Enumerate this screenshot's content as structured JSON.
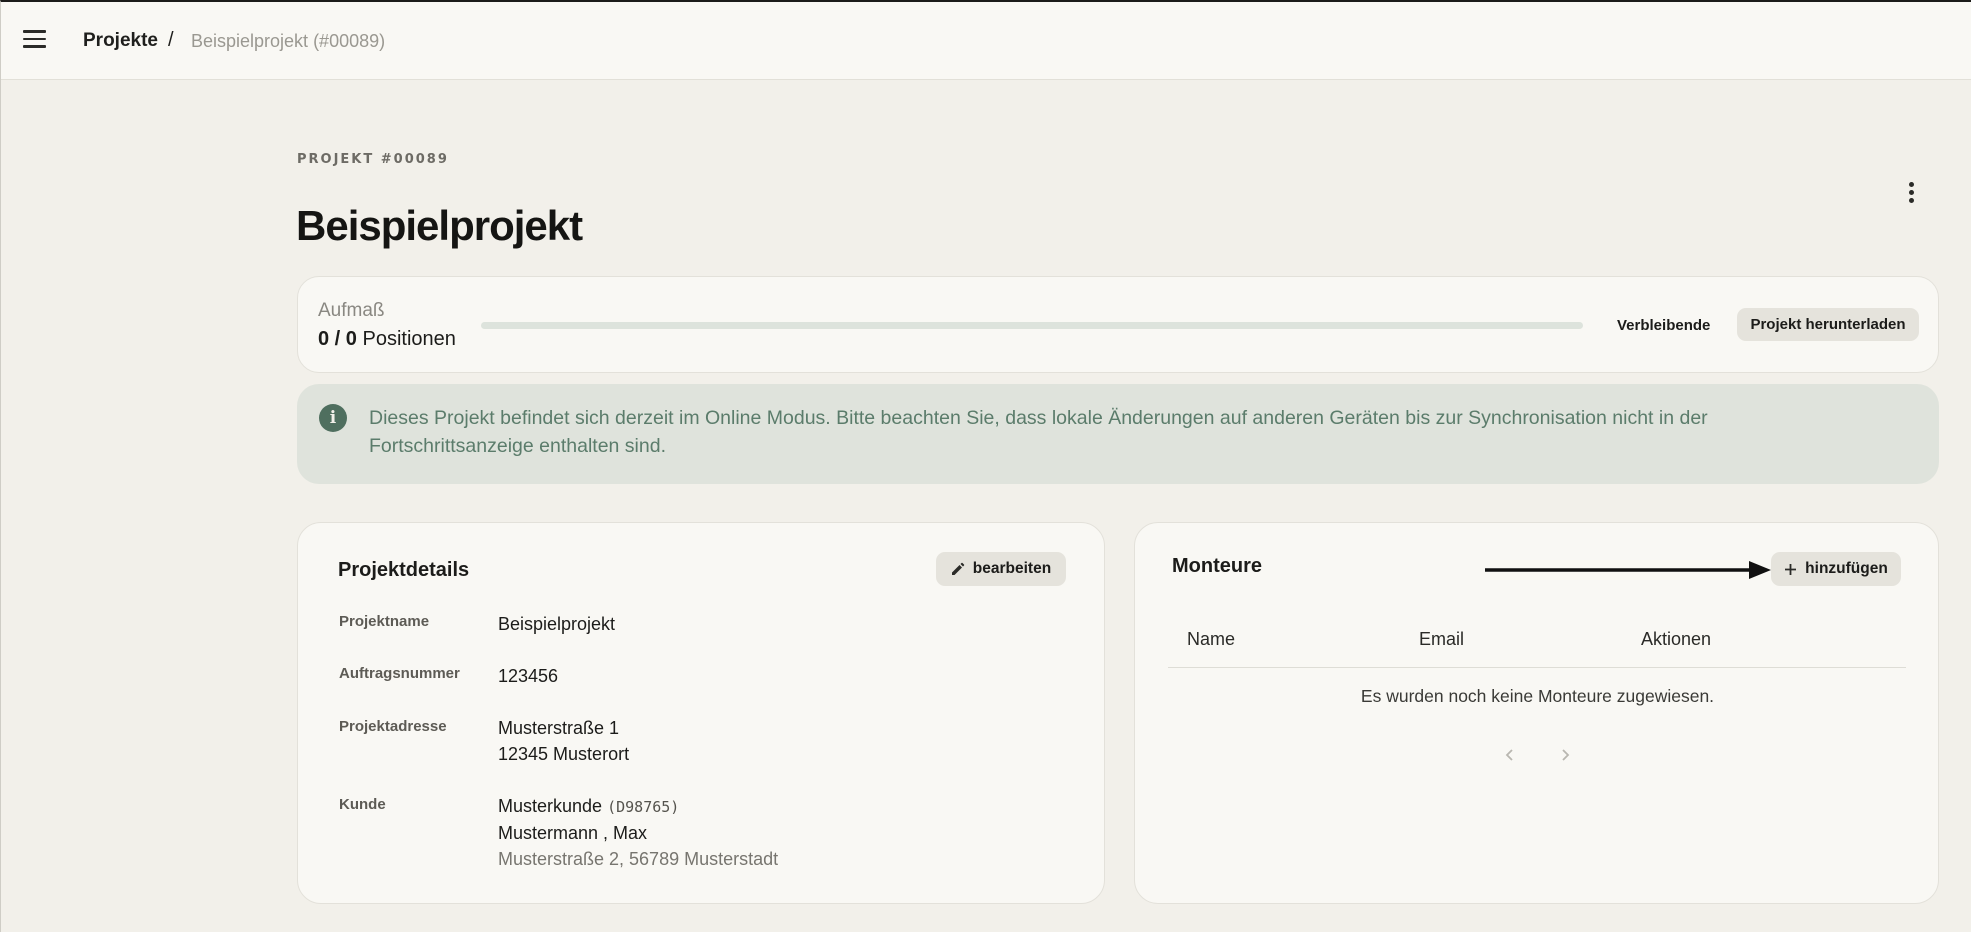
{
  "breadcrumb": {
    "root": "Projekte",
    "separator": "/",
    "current": "Beispielprojekt (#00089)"
  },
  "project": {
    "eyebrow": "PROJEKT #00089",
    "title": "Beispielprojekt"
  },
  "progress": {
    "label": "Aufmaß",
    "count_done": "0 / 0",
    "count_unit": "Positionen",
    "fraction": 0,
    "remaining_label": "Verbleibende",
    "download_label": "Projekt herunterladen"
  },
  "info": {
    "text": "Dieses Projekt befindet sich derzeit im Online Modus. Bitte beachten Sie, dass lokale Änderungen auf anderen Geräten bis zur Synchronisation nicht in der Fortschrittsanzeige enthalten sind."
  },
  "details": {
    "title": "Projektdetails",
    "edit_label": "bearbeiten",
    "rows": {
      "name_label": "Projektname",
      "name_value": "Beispielprojekt",
      "order_label": "Auftragsnummer",
      "order_value": "123456",
      "address_label": "Projektadresse",
      "address_line1": "Musterstraße 1",
      "address_line2": "12345 Musterort",
      "customer_label": "Kunde",
      "customer_name": "Musterkunde",
      "customer_id": "(D98765)",
      "customer_contact": "Mustermann , Max",
      "customer_address": "Musterstraße 2, 56789 Musterstadt"
    }
  },
  "monteure": {
    "title": "Monteure",
    "add_label": "hinzufügen",
    "columns": [
      "Name",
      "Email",
      "Aktionen"
    ],
    "empty_message": "Es wurden noch keine Monteure zugewiesen."
  },
  "colors": {
    "accent": "#5b7a6a",
    "background": "#f2f0ea",
    "card": "#f9f8f4",
    "info_bg": "#dfe3dc"
  },
  "icons": [
    "menu-icon",
    "more-vertical-icon",
    "info-icon",
    "pencil-icon",
    "plus-icon",
    "chevron-left-icon",
    "chevron-right-icon"
  ]
}
